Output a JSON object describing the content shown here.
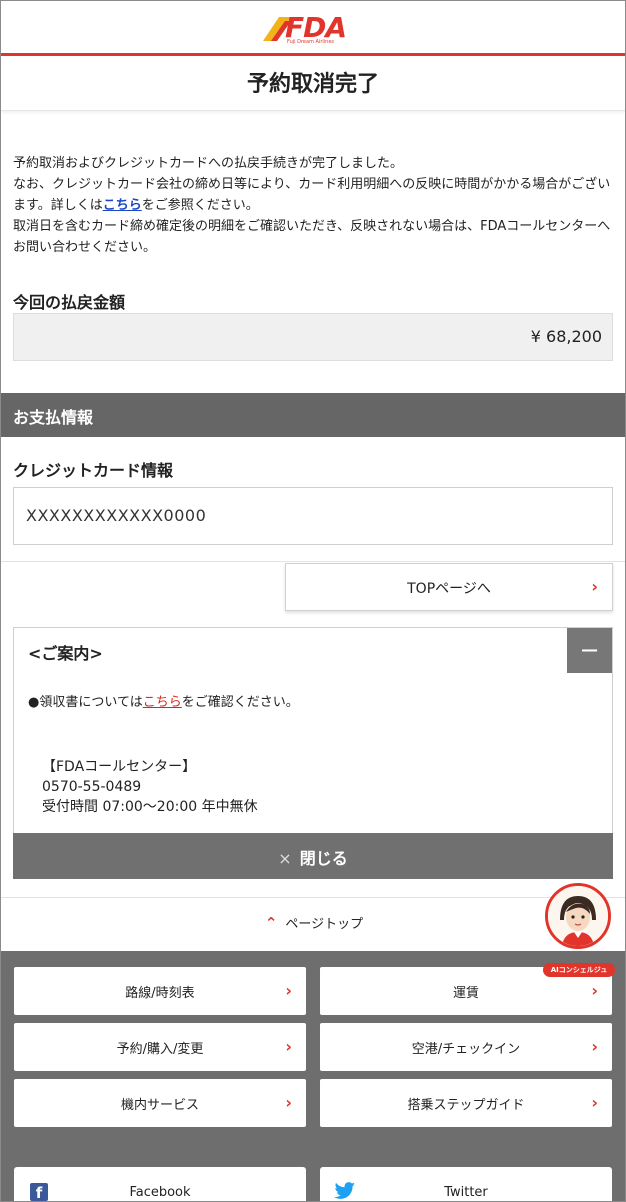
{
  "brand": {
    "name": "FDA",
    "tagline": "Fuji Dream Airlines"
  },
  "page": {
    "title": "予約取消完了"
  },
  "message": {
    "line1": "予約取消およびクレジットカードへの払戻手続きが完了しました。",
    "line2a": "なお、クレジットカード会社の締め日等により、カード利用明細への反映に時間がかかる場合がございます。詳しくは",
    "line2_link": "こちら",
    "line2b": "をご参照ください。",
    "line3": "取消日を含むカード締め確定後の明細をご確認いただき、反映されない場合は、FDAコールセンターへお問い合わせください。"
  },
  "refund": {
    "label": "今回の払戻金額",
    "amount": "¥ 68,200"
  },
  "payment": {
    "section_title": "お支払情報",
    "card_label": "クレジットカード情報",
    "card_number": "XXXXXXXXXXXX0000"
  },
  "top_button": {
    "label": "TOPページへ"
  },
  "guide": {
    "title": "<ご案内>",
    "collapse_symbol": "−",
    "receipt_prefix": "●領収書については",
    "receipt_link": "こちら",
    "receipt_suffix": "をご確認ください。",
    "center_name": "【FDAコールセンター】",
    "center_phone": "0570-55-0489",
    "center_hours": "受付時間  07:00〜20:00  年中無休",
    "close_symbol": "×",
    "close_label": "閉じる"
  },
  "pagetop": {
    "label": "ページトップ"
  },
  "concierge": {
    "label": "AIコンシェルジュ"
  },
  "footer": {
    "nav": [
      {
        "label": "路線/時刻表"
      },
      {
        "label": "運賃"
      },
      {
        "label": "予約/購入/変更"
      },
      {
        "label": "空港/チェックイン"
      },
      {
        "label": "機内サービス"
      },
      {
        "label": "搭乗ステップガイド"
      }
    ],
    "social": [
      {
        "label": "Facebook"
      },
      {
        "label": "Twitter"
      }
    ]
  },
  "colors": {
    "accent": "#e1352b",
    "section_bar": "#666666",
    "link_blue": "#1a47c8"
  }
}
